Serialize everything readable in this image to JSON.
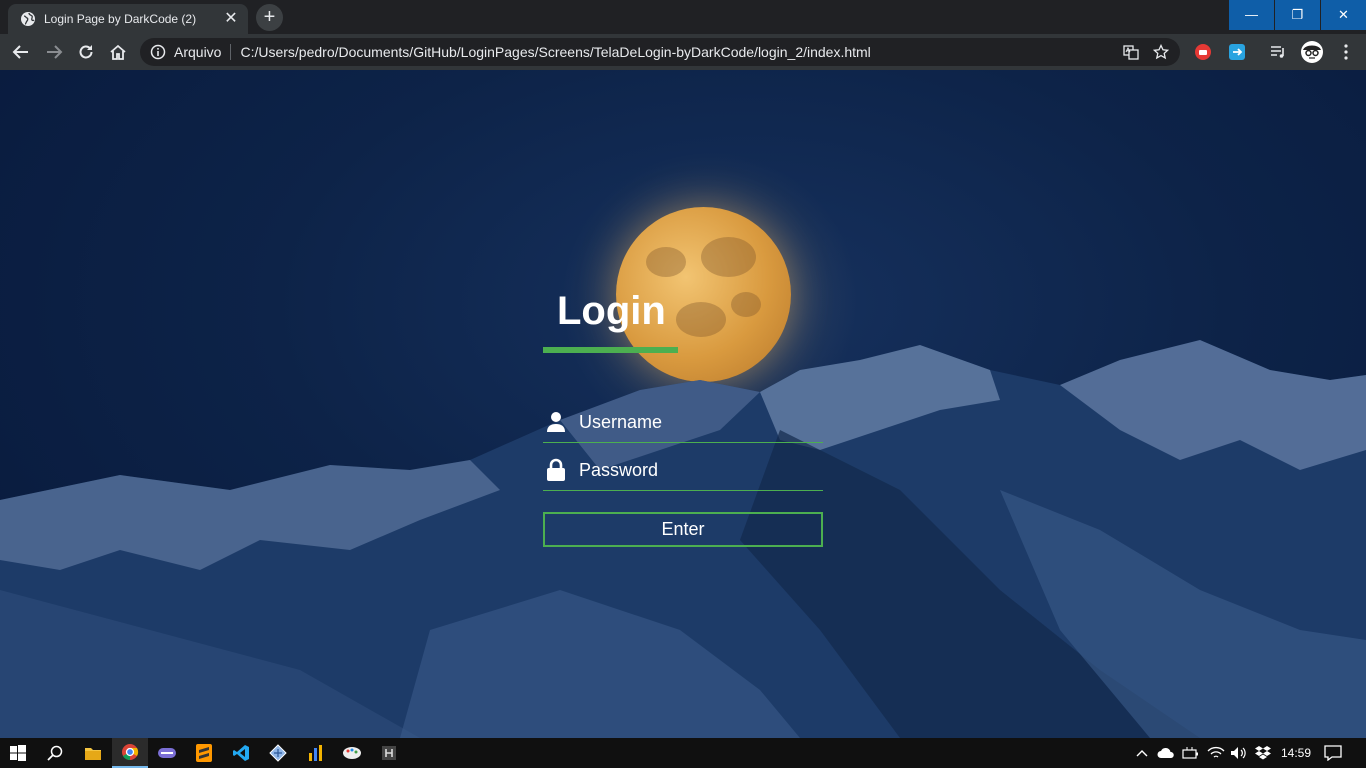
{
  "browser": {
    "tab": {
      "title": "Login Page by DarkCode (2)",
      "close": "✕"
    },
    "new_tab": "+",
    "window_buttons": {
      "minimize": "—",
      "restore": "❐",
      "close": "✕"
    },
    "address": {
      "scheme_label": "Arquivo",
      "url": "C:/Users/pedro/Documents/GitHub/LoginPages/Screens/TelaDeLogin-byDarkCode/login_2/index.html"
    }
  },
  "login": {
    "title": "Login",
    "username_placeholder": "Username",
    "password_placeholder": "Password",
    "enter_label": "Enter"
  },
  "taskbar": {
    "clock": "14:59"
  },
  "colors": {
    "accent": "#4caf50",
    "window_controls": "#0f5ea8"
  }
}
